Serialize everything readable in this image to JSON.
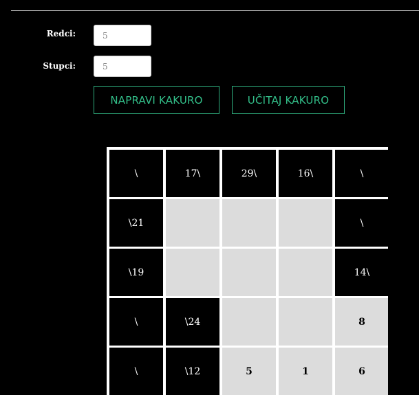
{
  "form": {
    "rows_label": "Redci:",
    "rows_value": "5",
    "cols_label": "Stupci:",
    "cols_value": "5"
  },
  "buttons": {
    "make": "NAPRAVI KAKURO",
    "load": "UČITAJ KAKURO"
  },
  "colors": {
    "background": "#000000",
    "accent": "#33c08a",
    "blank_cell": "#dcdcdc",
    "clue_cell": "#000000"
  },
  "board": {
    "rows": [
      [
        {
          "type": "clue",
          "text": "\\"
        },
        {
          "type": "clue",
          "text": "17\\"
        },
        {
          "type": "clue",
          "text": "29\\"
        },
        {
          "type": "clue",
          "text": "16\\"
        },
        {
          "type": "clue",
          "text": "\\"
        }
      ],
      [
        {
          "type": "clue",
          "text": "\\21"
        },
        {
          "type": "blank",
          "text": ""
        },
        {
          "type": "blank",
          "text": ""
        },
        {
          "type": "blank",
          "text": ""
        },
        {
          "type": "clue",
          "text": "\\"
        }
      ],
      [
        {
          "type": "clue",
          "text": "\\19"
        },
        {
          "type": "blank",
          "text": ""
        },
        {
          "type": "blank",
          "text": ""
        },
        {
          "type": "blank",
          "text": ""
        },
        {
          "type": "clue",
          "text": "14\\"
        }
      ],
      [
        {
          "type": "clue",
          "text": "\\"
        },
        {
          "type": "clue",
          "text": "\\24"
        },
        {
          "type": "blank",
          "text": ""
        },
        {
          "type": "blank",
          "text": ""
        },
        {
          "type": "blank",
          "text": "8"
        }
      ],
      [
        {
          "type": "clue",
          "text": "\\"
        },
        {
          "type": "clue",
          "text": "\\12"
        },
        {
          "type": "blank",
          "text": "5"
        },
        {
          "type": "blank",
          "text": "1"
        },
        {
          "type": "blank",
          "text": "6"
        }
      ]
    ]
  }
}
